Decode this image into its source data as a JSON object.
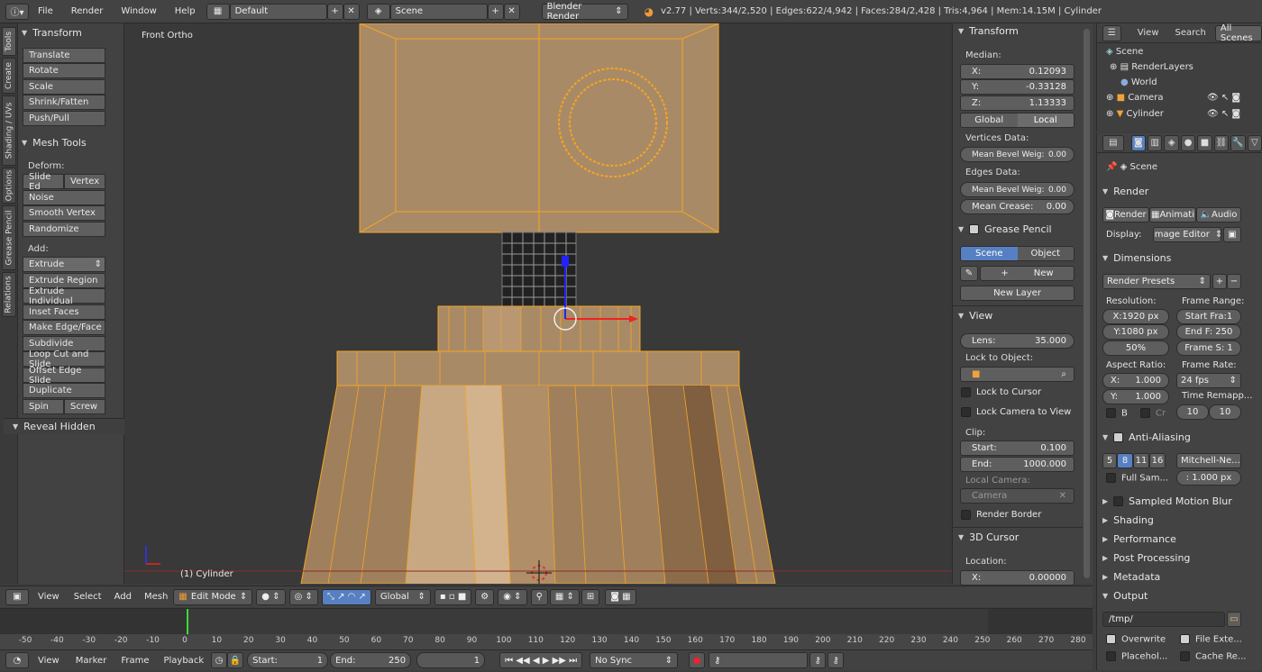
{
  "topbar": {
    "menus": [
      "File",
      "Render",
      "Window",
      "Help"
    ],
    "layout": "Default",
    "scene": "Scene",
    "engine": "Blender Render",
    "stats": "v2.77 | Verts:344/2,520 | Edges:622/4,942 | Faces:284/2,428 | Tris:4,964 | Mem:14.15M | Cylinder"
  },
  "left_tabs": [
    "Tools",
    "Create",
    "Shading / UVs",
    "Options",
    "Grease Pencil",
    "Relations"
  ],
  "tools": {
    "transform_header": "Transform",
    "transform": [
      "Translate",
      "Rotate",
      "Scale",
      "Shrink/Fatten",
      "Push/Pull"
    ],
    "mesh_header": "Mesh Tools",
    "deform_label": "Deform:",
    "slide_edge": "Slide Ed",
    "vertex": "Vertex",
    "deform": [
      "Noise",
      "Smooth Vertex",
      "Randomize"
    ],
    "add_label": "Add:",
    "extrude": "Extrude",
    "add": [
      "Extrude Region",
      "Extrude Individual",
      "Inset Faces",
      "Make Edge/Face",
      "Subdivide",
      "Loop Cut and Slide",
      "Offset Edge Slide",
      "Duplicate"
    ],
    "spin": "Spin",
    "screw": "Screw",
    "reveal": "Reveal Hidden"
  },
  "viewport": {
    "view_name": "Front Ortho",
    "object_label": "(1) Cylinder"
  },
  "npanel": {
    "transform_header": "Transform",
    "median": "Median:",
    "x_label": "X:",
    "x": "0.12093",
    "y_label": "Y:",
    "y": "-0.33128",
    "z_label": "Z:",
    "z": "1.13333",
    "global": "Global",
    "local": "Local",
    "vertices_data": "Vertices Data:",
    "mean_bevel": "Mean Bevel Weig:",
    "mean_bevel_v": "0.00",
    "edges_data": "Edges Data:",
    "mean_bevel_e": "0.00",
    "mean_crease": "Mean Crease:",
    "mean_crease_v": "0.00",
    "grease_header": "Grease Pencil",
    "gp_scene": "Scene",
    "gp_object": "Object",
    "gp_new": "New",
    "gp_new_layer": "New Layer",
    "view_header": "View",
    "lens": "Lens:",
    "lens_v": "35.000",
    "lock_object": "Lock to Object:",
    "lock_cursor": "Lock to Cursor",
    "lock_camera": "Lock Camera to View",
    "clip": "Clip:",
    "clip_start": "Start:",
    "clip_start_v": "0.100",
    "clip_end": "End:",
    "clip_end_v": "1000.000",
    "local_camera": "Local Camera:",
    "camera": "Camera",
    "render_border": "Render Border",
    "cursor_header": "3D Cursor",
    "location": "Location:",
    "cx": "X:",
    "cx_v": "0.00000"
  },
  "outliner": {
    "view": "View",
    "search": "Search",
    "all_scenes": "All Scenes",
    "items": [
      "Scene",
      "RenderLayers",
      "World",
      "Camera",
      "Cylinder"
    ]
  },
  "properties": {
    "scene": "Scene",
    "render_header": "Render",
    "render_btn": "Render",
    "anim_btn": "Animati",
    "audio_btn": "Audio",
    "display": "Display:",
    "display_v": "Image Editor",
    "dimensions": "Dimensions",
    "presets": "Render Presets",
    "resolution": "Resolution:",
    "res_x": "X:1920 px",
    "res_y": "Y:1080 px",
    "res_pct": "50%",
    "frame_range": "Frame Range:",
    "start": "Start Fra:1",
    "end": "End F: 250",
    "step": "Frame S: 1",
    "aspect": "Aspect Ratio:",
    "asp_x": "X:",
    "asp_x_v": "1.000",
    "asp_y": "Y:",
    "asp_y_v": "1.000",
    "frame_rate": "Frame Rate:",
    "fps": "24 fps",
    "time_remap": "Time Remapp...",
    "remap_a": "10",
    "remap_b": "10",
    "b_label": "B",
    "cr_label": "Cr",
    "aa": "Anti-Aliasing",
    "aa_samples": [
      "5",
      "8",
      "11",
      "16"
    ],
    "filter": "Mitchell-Ne...",
    "full_sample": "Full Sam...",
    "filter_size": ": 1.000 px",
    "smb": "Sampled Motion Blur",
    "shading": "Shading",
    "performance": "Performance",
    "post": "Post Processing",
    "metadata": "Metadata",
    "output": "Output",
    "path": "/tmp/",
    "overwrite": "Overwrite",
    "file_ext": "File Exte...",
    "placeholders": "Placehol...",
    "cache": "Cache Re..."
  },
  "view_header": {
    "menus": [
      "View",
      "Select",
      "Add",
      "Mesh"
    ],
    "mode": "Edit Mode",
    "orientation": "Global"
  },
  "timeline": {
    "ticks": [
      "-50",
      "-40",
      "-30",
      "-20",
      "-10",
      "0",
      "10",
      "20",
      "30",
      "40",
      "50",
      "60",
      "70",
      "80",
      "90",
      "100",
      "110",
      "120",
      "130",
      "140",
      "150",
      "160",
      "170",
      "180",
      "190",
      "200",
      "210",
      "220",
      "230",
      "240",
      "250",
      "260",
      "270",
      "280"
    ],
    "current_frame": 1
  },
  "tl_header": {
    "menus": [
      "View",
      "Marker",
      "Frame",
      "Playback"
    ],
    "start": "Start:",
    "start_v": "1",
    "end": "End:",
    "end_v": "250",
    "frame": "1",
    "sync": "No Sync"
  },
  "colors": {
    "accent": "#5680c2",
    "mesh_fill": "#a98a66",
    "mesh_edge": "#f5a623",
    "bg": "#393939"
  }
}
